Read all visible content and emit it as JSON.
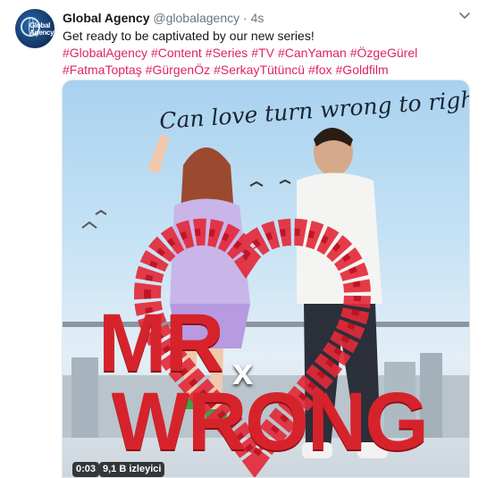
{
  "tweet": {
    "author_name": "Global Agency",
    "handle": "@globalagency",
    "separator": "·",
    "timestamp": "4s",
    "text": "Get ready to be captivated by our new series!",
    "hashtags_line1": [
      "#GlobalAgency",
      "#Content",
      "#Series",
      "#TV",
      "#CanYaman",
      "#ÖzgeGürel"
    ],
    "hashtags_line2": [
      "#FatmaToptaş",
      "#GürgenÖz",
      "#SerkayTütüncü",
      "#fox",
      "#Goldfilm"
    ],
    "avatar_text": "Global Agency"
  },
  "media": {
    "tagline": "Can love turn wrong to right?",
    "title_top": "MR",
    "title_x": "x",
    "title_bottom": "WRONG",
    "duration": "0:03",
    "views": "9,1 B izleyici"
  },
  "colors": {
    "hashtag": "#e0245e",
    "title_red": "#d6232b"
  },
  "icons": {
    "more": "chevron-down-icon"
  }
}
